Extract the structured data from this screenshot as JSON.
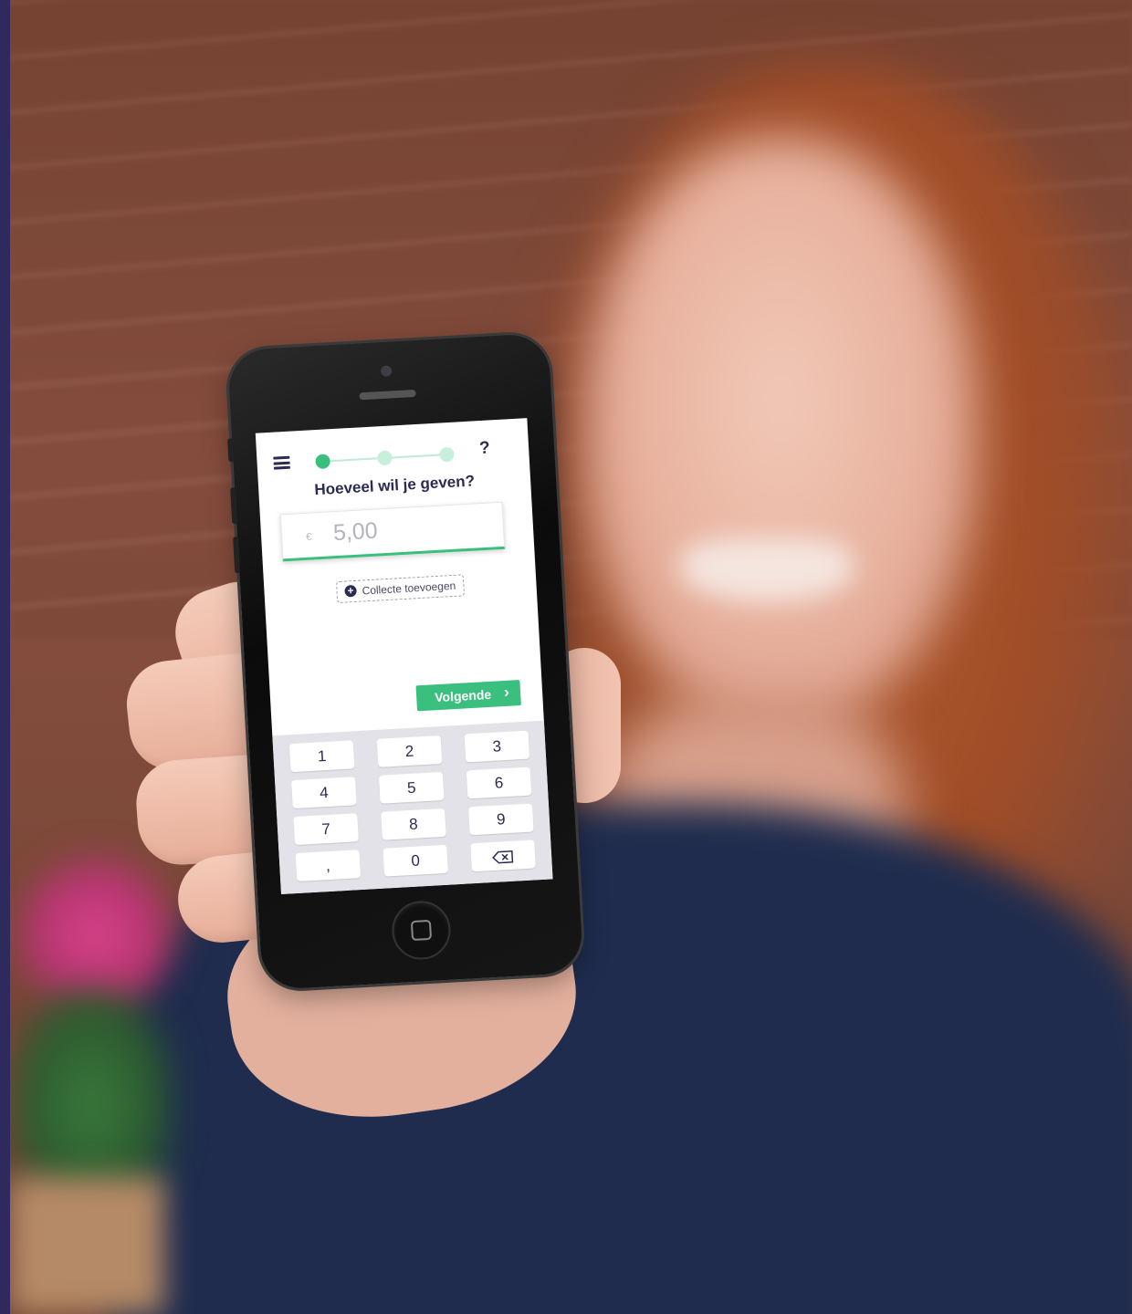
{
  "app": {
    "title": "Hoeveel wil je geven?",
    "help_label": "?",
    "steps": {
      "total": 3,
      "current": 1
    }
  },
  "amount": {
    "currency": "€",
    "value": "5,00"
  },
  "collecte": {
    "label": "Collecte toevoegen"
  },
  "next_button": {
    "label": "Volgende",
    "chevron": "›"
  },
  "keypad": {
    "keys": [
      "1",
      "2",
      "3",
      "4",
      "5",
      "6",
      "7",
      "8",
      "9",
      ",",
      "0"
    ],
    "backspace_icon": "backspace-icon"
  },
  "colors": {
    "accent": "#3bbf7e",
    "accent_light": "#c7efd9",
    "text_dark": "#2b2b52",
    "keypad_bg": "#e2e2e8"
  }
}
